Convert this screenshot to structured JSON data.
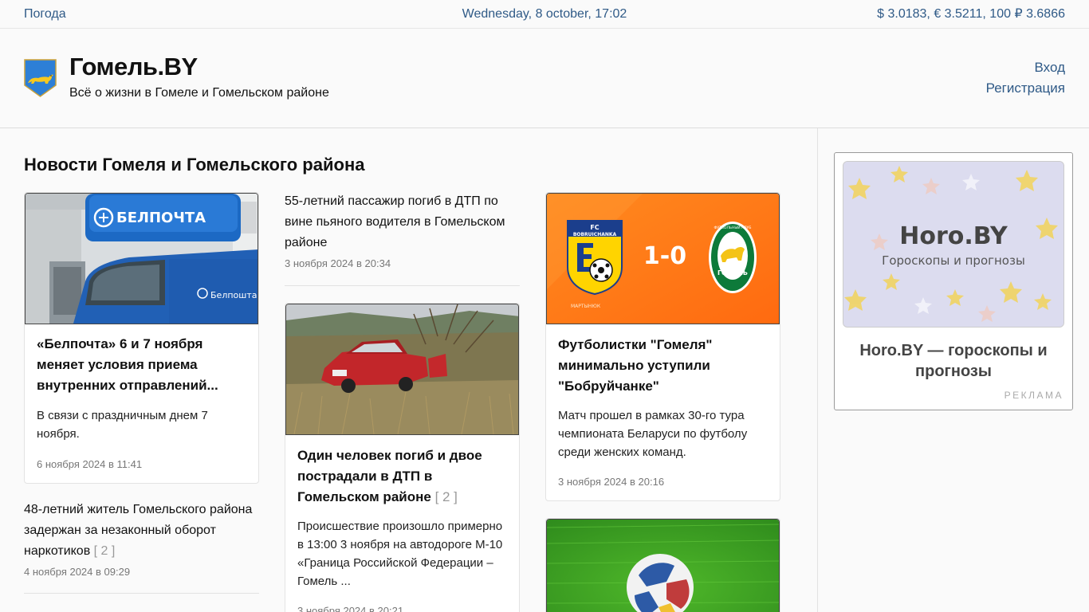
{
  "topbar": {
    "weather": "Погода",
    "datetime": "Wednesday, 8 october, 17:02",
    "rates": "$ 3.0183, € 3.5211, 100 ₽ 3.6866"
  },
  "header": {
    "title": "Гомель.BY",
    "subtitle": "Всё о жизни в Гомеле и Гомельском районе",
    "login": "Вход",
    "register": "Регистрация"
  },
  "main": {
    "section_title": "Новости Гомеля и Гомельского района",
    "card1": {
      "sign_text": "БЕЛПОЧТА",
      "van_text": "Белпошта",
      "title": "«Белпочта» 6 и 7 ноября меняет условия приема внутренних отправлений...",
      "desc": "В связи с праздничным днем 7 ноября.",
      "date": "6 ноября 2024 в 11:41"
    },
    "plain1": {
      "title": "48-летний житель Гомельского района задержан за незаконный оборот наркотиков",
      "count": "[ 2 ]",
      "date": "4 ноября 2024 в 09:29"
    },
    "plain2": {
      "title": "55-летний пассажир погиб в ДТП по вине пьяного водителя в Гомельском районе",
      "date": "3 ноября 2024 в 20:34"
    },
    "card2": {
      "title": "Один человек погиб и двое пострадали в ДТП в Гомельском районе",
      "count": "[ 2 ]",
      "desc": "Происшествие произошло примерно в 13:00 3 ноября на автодороге М-10 «Граница Российской Федерации – Гомель ...",
      "date": "3 ноября 2024 в 20:21"
    },
    "card3": {
      "score": "1-0",
      "club_left_top": "FC",
      "club_left_name": "BOBRUICHANKA",
      "club_right_ring": "ФУТБОЛЬНЫЙ КЛУБ",
      "club_right_name": "ГОМЕЛЬ",
      "sponsor": "МАРТЫНЮК",
      "title": "Футболистки \"Гомеля\" минимально уступили \"Бобруйчанке\"",
      "desc": "Матч прошел в рамках 30-го тура чемпионата Беларуси по футболу среди женских команд.",
      "date": "3 ноября 2024 в 20:16"
    }
  },
  "ad": {
    "brand": "Horo.BY",
    "tagline": "Гороскопы и прогнозы",
    "title": "Horo.BY — гороскопы и прогнозы",
    "label": "РЕКЛАМА"
  },
  "colors": {
    "link": "#2f5a87",
    "accent_orange": "#ff7a1a",
    "brand_yellow": "#ffd500"
  }
}
